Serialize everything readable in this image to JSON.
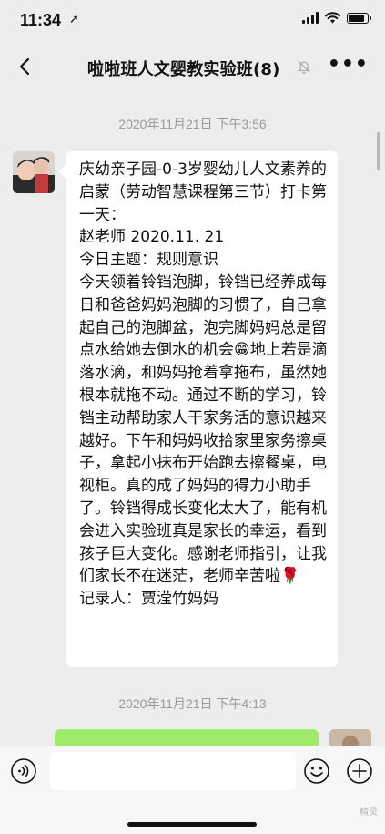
{
  "status_bar": {
    "time": "11:34",
    "location_glyph": "➚"
  },
  "header": {
    "title": "啦啦班人文婴教实验班(8)",
    "more_label": "•••"
  },
  "messages": [
    {
      "timestamp": "2020年11月21日 下午3:56",
      "text": "庆幼亲子园-0-3岁婴幼儿人文素养的启蒙（劳动智慧课程第三节）打卡第一天：\n赵老师 2020.11. 21\n今日主题：规则意识\n今天领着铃铛泡脚，铃铛已经养成每日和爸爸妈妈泡脚的习惯了，自己拿起自己的泡脚盆，泡完脚妈妈总是留点水给她去倒水的机会😁地上若是滴落水滴，和妈妈抢着拿拖布，虽然她根本就拖不动。通过不断的学习，铃铛主动帮助家人干家务活的意识越来越好。下午和妈妈收拾家里家务擦桌子，拿起小抹布开始跑去擦餐桌，电视柜。真的成了妈妈的得力小助手了。铃铛得成长变化太大了，能有机会进入实验班真是家长的幸运，看到孩子巨大变化。感谢老师指引，让我们家长不在迷茫，老师辛苦啦🌹\n记录人：贾滢竹妈妈"
    },
    {
      "timestamp": "2020年11月21日 下午4:13"
    }
  ],
  "input_bar": {
    "placeholder": ""
  },
  "watermark": "精灵"
}
